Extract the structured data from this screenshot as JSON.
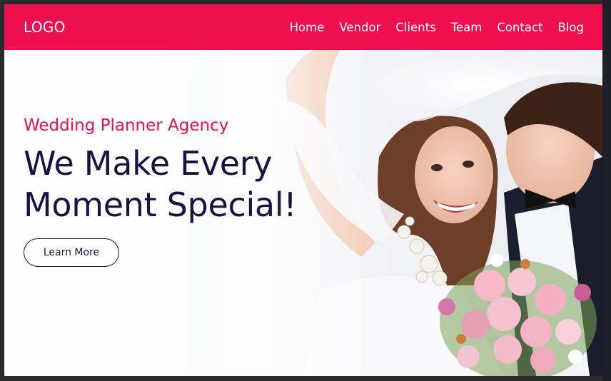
{
  "navbar": {
    "logo": "LOGO",
    "items": [
      {
        "label": "Home"
      },
      {
        "label": "Vendor"
      },
      {
        "label": "Clients"
      },
      {
        "label": "Team"
      },
      {
        "label": "Contact"
      },
      {
        "label": "Blog"
      }
    ]
  },
  "hero": {
    "subtitle": "Wedding Planner Agency",
    "title": "We Make Every Moment Special!",
    "button_label": "Learn More"
  },
  "colors": {
    "brand": "#ee0f4e",
    "heading": "#1b1142"
  }
}
